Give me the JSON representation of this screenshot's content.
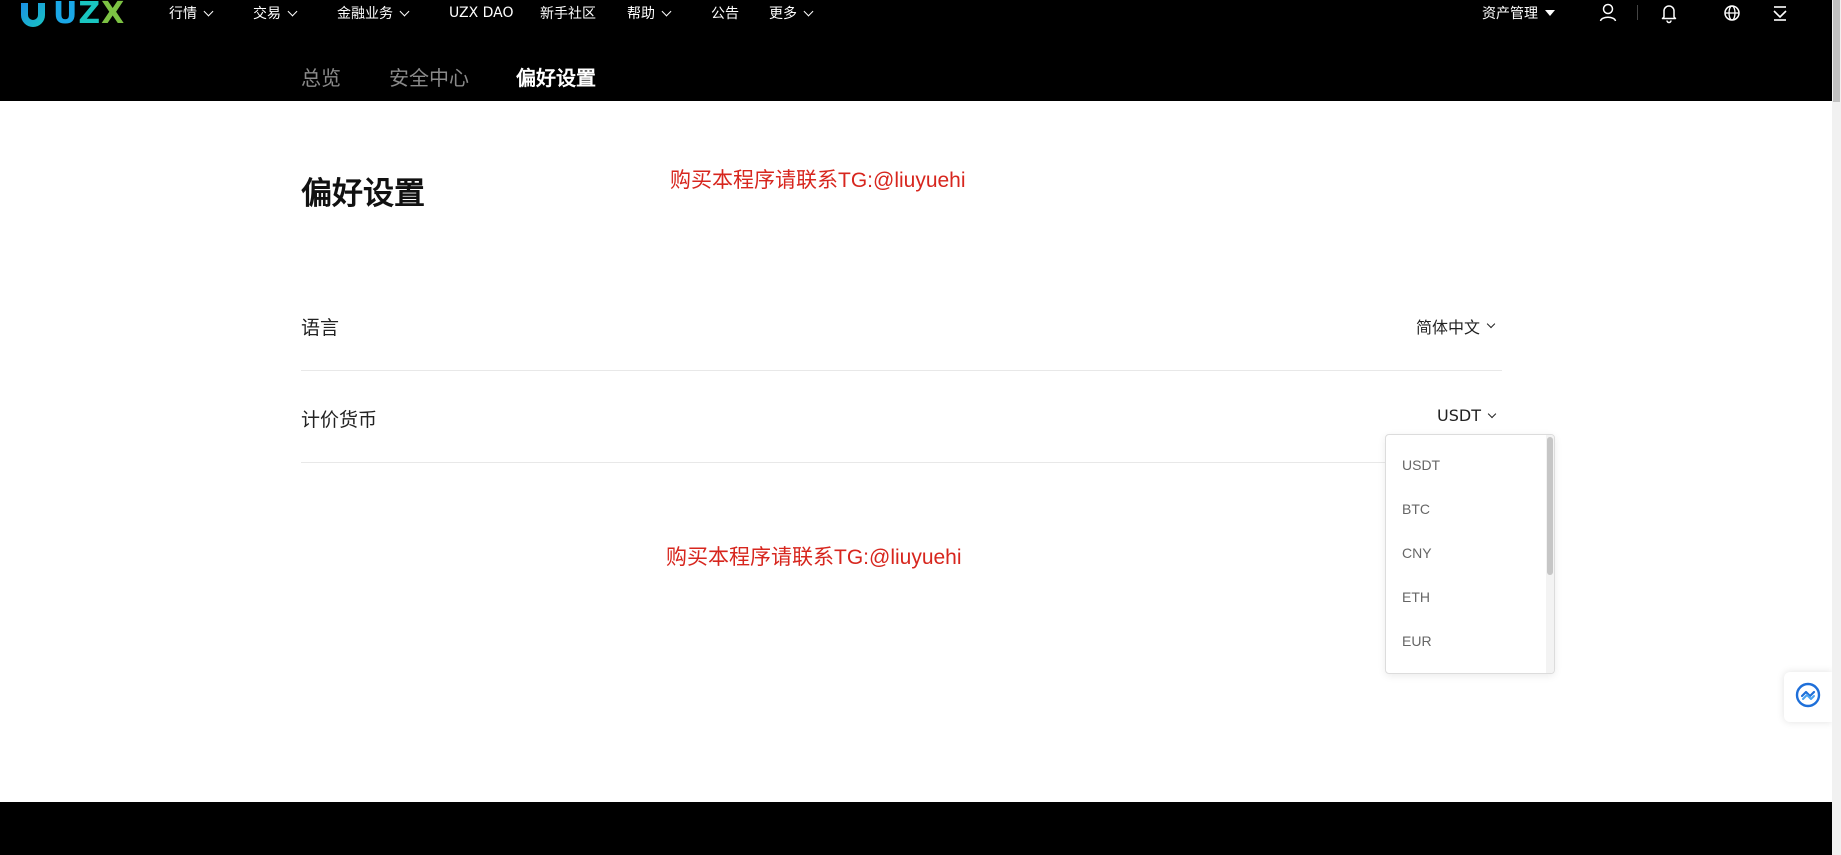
{
  "brand": {
    "logo_text_u": "U",
    "logo_text_z": "Z",
    "logo_text_x": "X"
  },
  "nav": {
    "items": [
      {
        "label": "行情"
      },
      {
        "label": "交易"
      },
      {
        "label": "金融业务"
      },
      {
        "label": "UZX DAO"
      },
      {
        "label": "新手社区"
      },
      {
        "label": "帮助"
      },
      {
        "label": "公告"
      },
      {
        "label": "更多"
      }
    ],
    "asset_menu": "资产管理"
  },
  "subnav": {
    "items": [
      {
        "label": "总览"
      },
      {
        "label": "安全中心"
      },
      {
        "label": "偏好设置"
      }
    ]
  },
  "page": {
    "title": "偏好设置",
    "watermark_top": "购买本程序请联系TG:@liuyuehi",
    "watermark_mid": "购买本程序请联系TG:@liuyuehi"
  },
  "settings": {
    "language": {
      "label": "语言",
      "value": "简体中文"
    },
    "currency": {
      "label": "计价货币",
      "value": "USDT"
    }
  },
  "currency_dropdown": {
    "options": [
      "USDT",
      "BTC",
      "CNY",
      "ETH",
      "EUR"
    ]
  },
  "colors": {
    "header_bg": "#000000",
    "watermark": "#d7261e",
    "accent_blue": "#1aa7e6"
  },
  "icons": [
    "user-icon",
    "bell-icon",
    "globe-icon",
    "download-icon",
    "support-icon"
  ]
}
